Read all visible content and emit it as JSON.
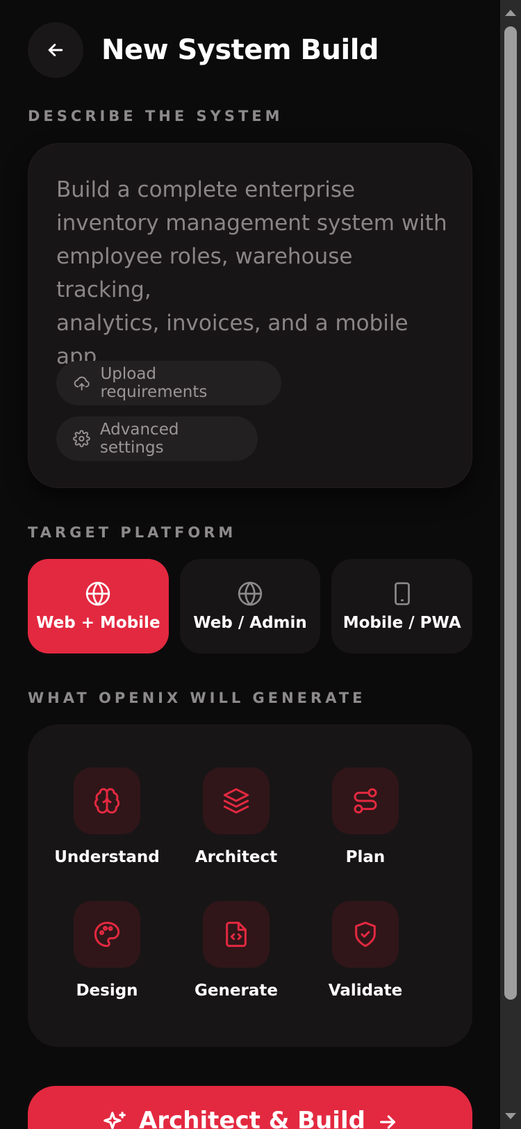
{
  "header": {
    "title": "New System Build",
    "back_icon": "arrow-left-icon"
  },
  "describe": {
    "section_label": "DESCRIBE THE SYSTEM",
    "placeholder_lines": [
      "Build a complete enterprise",
      "inventory management system with",
      "employee roles, warehouse tracking,",
      "analytics, invoices, and a mobile",
      "app..."
    ],
    "upload_label": "Upload requirements",
    "advanced_label": "Advanced settings"
  },
  "platform": {
    "section_label": "TARGET PLATFORM",
    "selected": "Web + Mobile",
    "options": [
      {
        "label": "Web + Mobile",
        "icon": "globe-icon"
      },
      {
        "label": "Web / Admin",
        "icon": "globe-icon"
      },
      {
        "label": "Mobile / PWA",
        "icon": "tablet-icon"
      }
    ]
  },
  "generate": {
    "section_label": "WHAT OPENIX WILL GENERATE",
    "items": [
      {
        "label": "Understand",
        "icon": "brain-icon"
      },
      {
        "label": "Architect",
        "icon": "layers-icon"
      },
      {
        "label": "Plan",
        "icon": "route-icon"
      },
      {
        "label": "Design",
        "icon": "palette-icon"
      },
      {
        "label": "Generate",
        "icon": "file-code-icon"
      },
      {
        "label": "Validate",
        "icon": "shield-check-icon"
      }
    ]
  },
  "cta": {
    "label": "Architect & Build"
  },
  "colors": {
    "accent": "#e32940",
    "background": "#0c0b0c",
    "card": "#181516",
    "icon_tile": "#301619",
    "muted_text": "#8d8a8b"
  }
}
